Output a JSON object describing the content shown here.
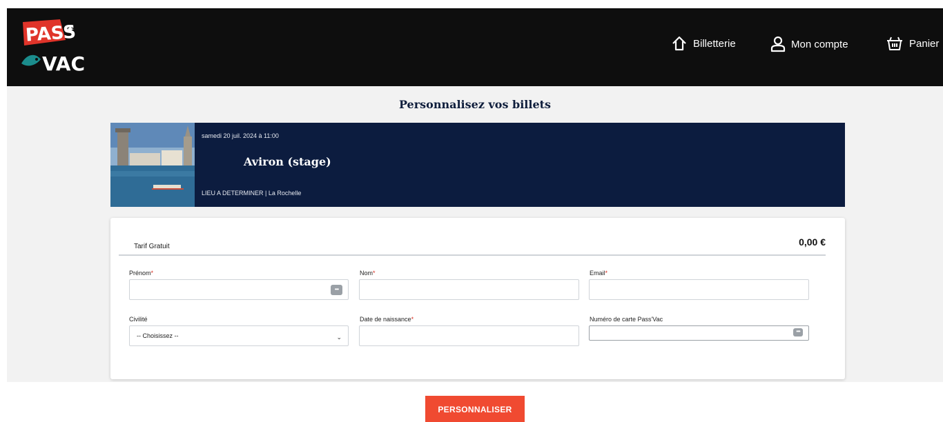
{
  "header": {
    "logo_text": [
      "PASS",
      "VAC"
    ],
    "nav": [
      {
        "label": "Billetterie",
        "icon": "home-icon"
      },
      {
        "label": "Mon compte",
        "icon": "user-icon"
      },
      {
        "label": "Panier",
        "icon": "basket-icon"
      }
    ]
  },
  "page_title": "Personnalisez vos billets",
  "event": {
    "date": "samedi 20 juil. 2024 à 11:00",
    "name": "Aviron (stage)",
    "venue": "LIEU A DETERMINER | La Rochelle",
    "photo_icon": "event-photo"
  },
  "tarif": {
    "label": "Tarif Gratuit",
    "price": "0,00 €"
  },
  "form": {
    "prenom_label": "Prénom",
    "nom_label": "Nom",
    "email_label": "Email",
    "civilite_label": "Civilité",
    "civilite_value": "-- Choisissez --",
    "naissance_label": "Date de naissance",
    "carte_label": "Numéro de carte Pass'Vac",
    "required_mark": "*"
  },
  "cta": {
    "label": "PERSONNALISER"
  },
  "colors": {
    "header_bg": "#0e0e0e",
    "banner_bg": "#0c1c3f",
    "cta_bg": "#f04a31",
    "required": "#d62d20",
    "logo_red": "#e0342a",
    "logo_teal": "#1b8c8c"
  }
}
